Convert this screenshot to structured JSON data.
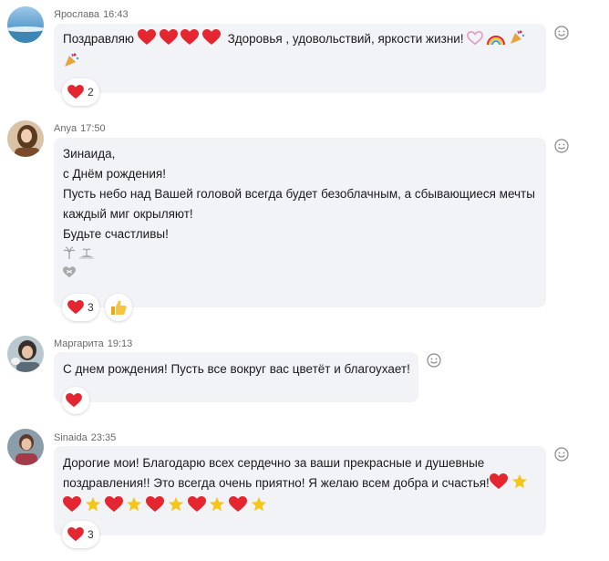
{
  "colors": {
    "bubble_bg": "#f2f3f7",
    "heart": "#e3262f",
    "star": "#f5c518",
    "meta": "#6a6a6a"
  },
  "messages": [
    {
      "author": "Ярослава",
      "time": "16:43",
      "text_parts": [
        "Поздравляю",
        "Здоровья , удовольствий,  яркости жизни!"
      ],
      "reaction_icon": "smile-add-icon",
      "reactions": [
        {
          "icon": "heart-icon",
          "count": "2"
        }
      ]
    },
    {
      "author": "Anya",
      "time": "17:50",
      "lines": [
        "Зинаида,",
        "с Днём рождения!",
        "Пусть небо над Вашей головой всегда будет безоблачным, а сбывающиеся мечты",
        "каждый миг окрыляют!",
        "Будьте счастливы!"
      ],
      "reaction_icon": "smile-add-icon",
      "reactions": [
        {
          "icon": "heart-icon",
          "count": "3"
        },
        {
          "icon": "thumbs-up-icon",
          "count": ""
        }
      ]
    },
    {
      "author": "Маргарита",
      "time": "19:13",
      "text": "С днем рождения! Пусть все вокруг вас цветёт и благоухает!",
      "reaction_icon": "smile-add-icon",
      "reactions": [
        {
          "icon": "heart-icon",
          "count": ""
        }
      ]
    },
    {
      "author": "Sinaida",
      "time": "23:35",
      "lines": [
        "Дорогие мои! Благодарю всех сердечно за ваши прекрасные и душевные",
        "поздравления!! Это всегда очень приятно! Я желаю всем добра и счастья!"
      ],
      "reaction_icon": "smile-add-icon",
      "reactions": [
        {
          "icon": "heart-icon",
          "count": "3"
        }
      ]
    }
  ]
}
